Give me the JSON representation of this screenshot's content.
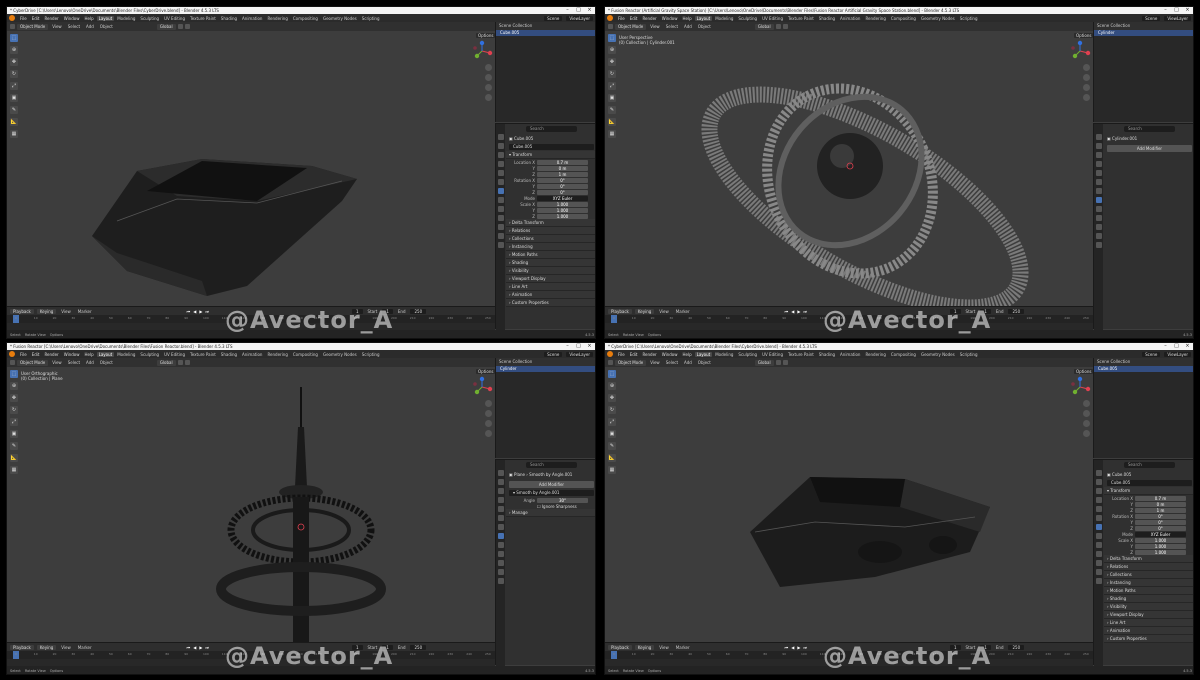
{
  "panes": [
    {
      "id": "p1",
      "title": "* CyberDrive [C:\\Users\\Lenovo\\OneDrive\\Documents\\Blender Files\\CyberDrive.blend] - Blender 4.5.3 LTS",
      "mode": "Object Mode",
      "orientation": "Global",
      "outliner_item": "Cube.005",
      "props_object": "Cube.005",
      "props_name": "Cube.005",
      "transform": {
        "location_x": "0.7 m",
        "y": "0 m",
        "z": "1 m",
        "rotation_x": "0°",
        "ry": "0°",
        "rz": "0°",
        "mode": "XYZ Euler",
        "scale_x": "1.000",
        "sy": "1.000",
        "sz": "1.000"
      },
      "frame": "1",
      "start": "1",
      "end": "250",
      "version": "4.5.3"
    },
    {
      "id": "p2",
      "title": "* Fusion Reactor (Artificial Gravity Space Station) [C:\\Users\\Lenovo\\OneDrive\\Documents\\Blender Files\\Fusion Reactor Artificial Gravity Space Station.blend] - Blender 4.5.3 LTS",
      "mode": "Object Mode",
      "orientation": "Global",
      "vp_line1": "User Perspective",
      "vp_line2": "(0) Collection | Cylinder.001",
      "outliner_item": "Cylinder",
      "props_object": "Cylinder.001",
      "add_modifier": "Add Modifier",
      "frame": "1",
      "start": "1",
      "end": "250",
      "version": "4.5.3"
    },
    {
      "id": "p3",
      "title": "* Fusion Reactor [C:\\Users\\Lenovo\\OneDrive\\Documents\\Blender Files\\Fusion Reactor.blend] - Blender 4.5.3 LTS",
      "mode": "Object Mode",
      "orientation": "Global",
      "vp_line1": "User Orthographic",
      "vp_line2": "(0) Collection | Plane",
      "outliner_item": "Cylinder",
      "props_object": "Plane",
      "props_modifier": "Smooth by Angle.001",
      "add_modifier": "Add Modifier",
      "mod_name": "Smooth by Angle.001",
      "angle_label": "Angle",
      "angle_value": "30°",
      "ignore_sharpness": "Ignore Sharpness",
      "manage": "Manage",
      "frame": "1",
      "start": "1",
      "end": "250",
      "version": "4.5.3"
    },
    {
      "id": "p4",
      "title": "* CyberDrive [C:\\Users\\Lenovo\\OneDrive\\Documents\\Blender Files\\CyberDrive.blend] - Blender 4.5.3 LTS",
      "mode": "Object Mode",
      "orientation": "Global",
      "outliner_item": "Cube.005",
      "props_object": "Cube.005",
      "props_name": "Cube.005",
      "transform": {
        "location_x": "0.7 m",
        "y": "0 m",
        "z": "1 m",
        "rotation_x": "0°",
        "ry": "0°",
        "rz": "0°",
        "mode": "XYZ Euler",
        "scale_x": "1.000",
        "sy": "1.000",
        "sz": "1.000"
      },
      "frame": "1",
      "start": "1",
      "end": "250",
      "version": "4.5.3"
    }
  ],
  "menu": [
    "File",
    "Edit",
    "Render",
    "Window",
    "Help"
  ],
  "workspaces": [
    "Layout",
    "Modeling",
    "Sculpting",
    "UV Editing",
    "Texture Paint",
    "Shading",
    "Animation",
    "Rendering",
    "Compositing",
    "Geometry Nodes",
    "Scripting"
  ],
  "scene_label": "Scene",
  "viewlayer_label": "ViewLayer",
  "header_menus": [
    "View",
    "Select",
    "Add",
    "Object"
  ],
  "options_label": "Options",
  "outliner_header": "Scene Collection",
  "search_placeholder": "Search",
  "sections": [
    "Transform",
    "Delta Transform",
    "Relations",
    "Collections",
    "Instancing",
    "Motion Paths",
    "Shading",
    "Visibility",
    "Viewport Display",
    "Line Art",
    "Animation",
    "Custom Properties"
  ],
  "labels": {
    "location_x": "Location X",
    "y": "Y",
    "z": "Z",
    "rotation_x": "Rotation X",
    "mode": "Mode",
    "scale_x": "Scale X"
  },
  "timeline": {
    "playback": "Playback",
    "keying": "Keying",
    "view": "View",
    "marker": "Marker",
    "start_label": "Start",
    "end_label": "End"
  },
  "ruler_ticks": [
    "0",
    "10",
    "20",
    "30",
    "40",
    "50",
    "60",
    "70",
    "80",
    "90",
    "100",
    "110",
    "120",
    "130",
    "140",
    "150",
    "160",
    "170",
    "180",
    "190",
    "200",
    "210",
    "220",
    "230",
    "240",
    "250"
  ],
  "status": {
    "select": "Select",
    "rotate": "Rotate View",
    "options": "Options"
  },
  "watermark": "@Avector_A",
  "icons": {
    "blender": "blender-logo-icon",
    "cursor": "cursor-tool-icon",
    "move": "move-icon",
    "rotate": "rotate-icon",
    "scale": "scale-icon",
    "transform": "transform-icon",
    "annotate": "annotate-icon",
    "measure": "measure-icon",
    "add": "add-cube-icon"
  },
  "colors": {
    "accent": "#4772b3",
    "blender_orange": "#e87d0d",
    "viewport": "#3d3d3d"
  }
}
